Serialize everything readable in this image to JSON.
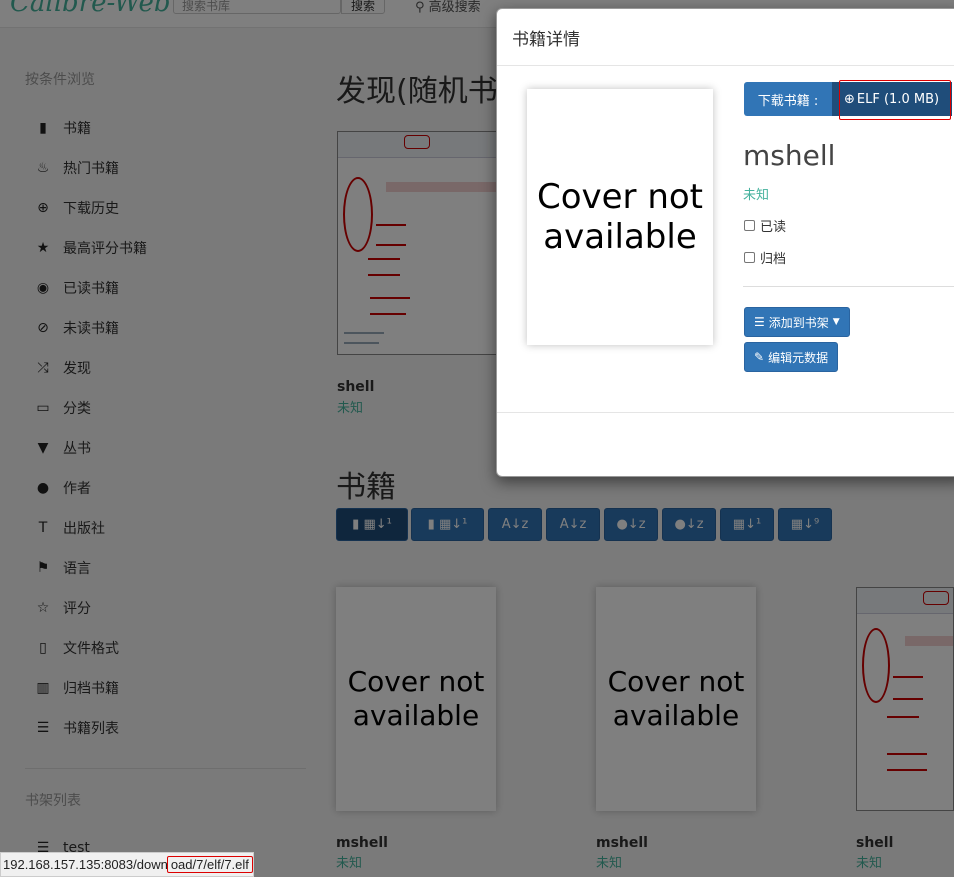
{
  "navbar": {
    "logo": "Calibre-Web",
    "search_placeholder": "搜索书库",
    "search_button": "搜索",
    "advanced_search": "高级搜索"
  },
  "sidebar": {
    "browse_heading": "按条件浏览",
    "items": [
      {
        "label": "书籍",
        "icon": "book-icon",
        "glyph": "▮"
      },
      {
        "label": "热门书籍",
        "icon": "fire-icon",
        "glyph": "♨"
      },
      {
        "label": "下载历史",
        "icon": "download-circle-icon",
        "glyph": "⊕"
      },
      {
        "label": "最高评分书籍",
        "icon": "star-icon",
        "glyph": "★"
      },
      {
        "label": "已读书籍",
        "icon": "eye-icon",
        "glyph": "◉"
      },
      {
        "label": "未读书籍",
        "icon": "eye-slash-icon",
        "glyph": "⊘"
      },
      {
        "label": "发现",
        "icon": "random-icon",
        "glyph": "⤮"
      },
      {
        "label": "分类",
        "icon": "inbox-icon",
        "glyph": "▭"
      },
      {
        "label": "丛书",
        "icon": "bookmark-icon",
        "glyph": "▼"
      },
      {
        "label": "作者",
        "icon": "user-icon",
        "glyph": "●"
      },
      {
        "label": "出版社",
        "icon": "text-size-icon",
        "glyph": "T"
      },
      {
        "label": "语言",
        "icon": "flag-icon",
        "glyph": "⚑"
      },
      {
        "label": "评分",
        "icon": "star-empty-icon",
        "glyph": "☆"
      },
      {
        "label": "文件格式",
        "icon": "file-icon",
        "glyph": "▯"
      },
      {
        "label": "归档书籍",
        "icon": "trash-icon",
        "glyph": "▥"
      },
      {
        "label": "书籍列表",
        "icon": "list-icon",
        "glyph": "☰"
      }
    ],
    "shelves_heading": "书架列表",
    "shelves": [
      {
        "label": "test",
        "icon": "list-icon",
        "glyph": "☰"
      }
    ]
  },
  "main": {
    "discover_heading": "发现(随机书",
    "discover_books": [
      {
        "title": "shell",
        "author": "未知"
      }
    ],
    "books_heading": "书籍",
    "sort_buttons": [
      {
        "name": "sort-newest-button",
        "label": "▮ ▦↓¹"
      },
      {
        "name": "sort-oldest-button",
        "label": "▮ ▦↓¹"
      },
      {
        "name": "sort-title-az-button",
        "label": "A↓z"
      },
      {
        "name": "sort-title-za-button",
        "label": "A↓z"
      },
      {
        "name": "sort-author-az-button",
        "label": "●↓z"
      },
      {
        "name": "sort-author-za-button",
        "label": "●↓z"
      },
      {
        "name": "sort-pubdate-asc-button",
        "label": "▦↓¹"
      },
      {
        "name": "sort-pubdate-desc-button",
        "label": "▦↓⁹"
      }
    ],
    "books": [
      {
        "title": "mshell",
        "author": "未知",
        "cover": "Cover not available"
      },
      {
        "title": "mshell",
        "author": "未知",
        "cover": "Cover not available"
      },
      {
        "title": "shell",
        "author": "未知",
        "cover": ""
      }
    ]
  },
  "modal": {
    "title": "书籍详情",
    "cover_text": "Cover not available",
    "download_label": "下载书籍 :",
    "download_format": "ELF (1.0 MB)",
    "book_title": "mshell",
    "author": "未知",
    "read_label": "已读",
    "archived_label": "归档",
    "add_to_shelf": "添加到书架",
    "edit_metadata": "编辑元数据"
  },
  "statusbar": {
    "url_prefix": "192.168.157.135:8083/down",
    "url_highlight": "oad/7/elf/7.elf"
  },
  "colors": {
    "primary": "#3175b6",
    "primary_dark": "#1f4d7a",
    "author_green": "#45b29d",
    "highlight_red": "#dd0000"
  }
}
